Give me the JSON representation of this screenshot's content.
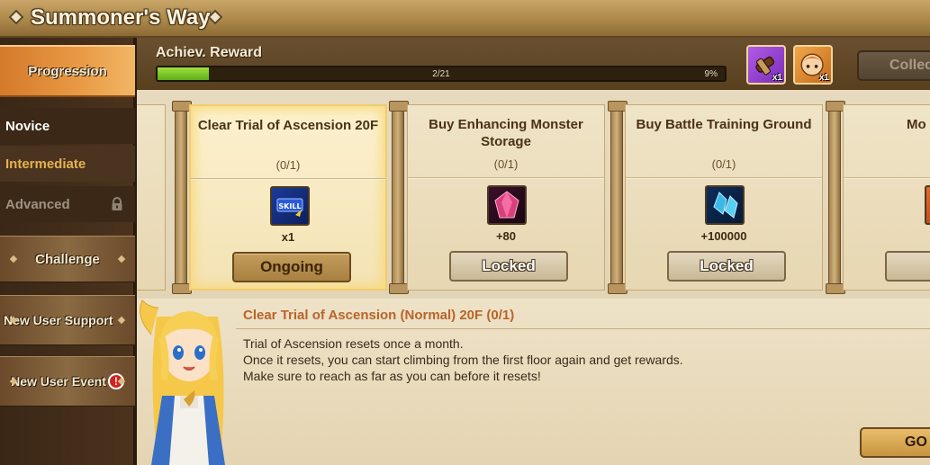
{
  "title": "Summoner's Way",
  "sidebar": {
    "progression": "Progression",
    "levels": {
      "novice": "Novice",
      "intermediate": "Intermediate",
      "advanced": "Advanced"
    },
    "challenge": "Challenge",
    "new_user_support": "New User Support",
    "new_user_event": "New User Event",
    "event_alert": "!"
  },
  "achievement": {
    "label": "Achiev. Reward",
    "progress_text": "2/21",
    "percent_text": "9%",
    "progress": 0.09,
    "rewards": [
      {
        "icon": "scroll-pack-icon",
        "qty": "x1"
      },
      {
        "icon": "monster-portrait-icon",
        "qty": "x1"
      }
    ],
    "collect_label": "Collect"
  },
  "quests": [
    {
      "title": "Clear Trial of Ascension 20F",
      "count": "(0/1)",
      "reward_icon": "skill-book-icon",
      "reward_amount": "x1",
      "button": "Ongoing"
    },
    {
      "title": "Buy Enhancing Monster Storage",
      "count": "(0/1)",
      "reward_icon": "crystal-icon",
      "reward_amount": "+80",
      "button": "Locked"
    },
    {
      "title": "Buy Battle Training Ground",
      "count": "(0/1)",
      "reward_icon": "mana-crystal-icon",
      "reward_amount": "+100000",
      "button": "Locked"
    },
    {
      "title": "Mo",
      "button": "Lo"
    }
  ],
  "description": {
    "title": "Clear Trial of Ascension (Normal) 20F (0/1)",
    "lines": [
      "Trial of Ascension resets once a month.",
      "Once it resets, you can start climbing from the first floor again and get rewards.",
      "Make sure to reach as far as you can before it resets!"
    ]
  },
  "go_label": "GO",
  "colors": {
    "active_tab": "#e99a45",
    "progress_fill": "#7cc428",
    "intermediate_text": "#e6b14f",
    "description_title": "#b8652a",
    "alert": "#d42020"
  }
}
